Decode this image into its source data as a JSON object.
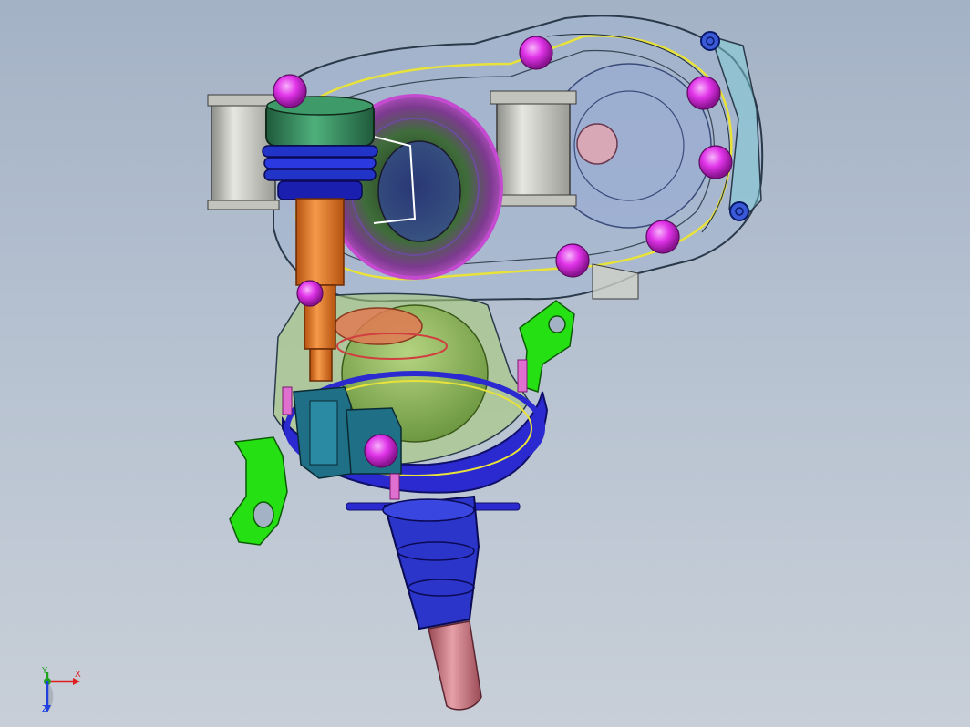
{
  "viewport": {
    "background_top": "#a4b2c6",
    "background_bottom": "#c8cfd8"
  },
  "model": {
    "part_colors": {
      "housing_outline": "#2b3a4a",
      "bolt_heads": "#e033e8",
      "cylinders": "#c9cbc3",
      "motor_cap": "#2f7d55",
      "bellows": "#2233c8",
      "piston_rod": "#e8731f",
      "gear_housing": "#7fb04a",
      "base_flange": "#2a2ad0",
      "bracket": "#25e012",
      "connector": "#1f6f86",
      "output_shaft_sleeve": "#2b35c9",
      "output_shaft": "#c9717a"
    }
  },
  "triad": {
    "x_label": "X",
    "y_label": "Y",
    "z_label": "Z",
    "x_color": "#e02020",
    "y_color": "#20a020",
    "z_color": "#2040e0"
  }
}
